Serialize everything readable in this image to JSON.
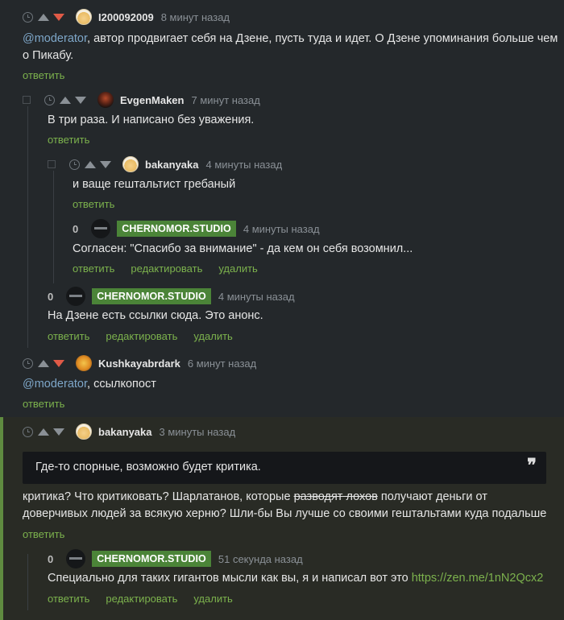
{
  "actions": {
    "reply": "ответить",
    "edit": "редактировать",
    "delete": "удалить"
  },
  "c1": {
    "nick": "I200092009",
    "time": "8 минут назад",
    "mention": "@moderator",
    "text": ", автор продвигает себя на Дзене, пусть туда и идет. О Дзене упоминания больше чем",
    "text2": "о Пикабу."
  },
  "c2": {
    "nick": "EvgenMaken",
    "time": "7 минут назад",
    "text": "В три раза. И написано без уважения."
  },
  "c3": {
    "nick": "bakanyaka",
    "time": "4 минуты назад",
    "text": "и ваще гештальтист гребаный"
  },
  "c4": {
    "rating": "0",
    "badge": "CHERNOMOR.STUDIO",
    "time": "4 минуты назад",
    "text": "Согласен: \"Спасибо за внимание\" - да кем он себя возомнил..."
  },
  "c5": {
    "rating": "0",
    "badge": "CHERNOMOR.STUDIO",
    "time": "4 минуты назад",
    "text": "На Дзене есть ссылки сюда. Это анонс."
  },
  "c6": {
    "nick": "Kushkayabrdark",
    "time": "6 минут назад",
    "mention": "@moderator",
    "text": ", ссылкопост"
  },
  "c7": {
    "nick": "bakanyaka",
    "time": "3 минуты назад",
    "quote": "Где-то спорные, возможно будет критика.",
    "qmark": "❞",
    "line1a": "критика? Что критиковать? Шарлатанов, которые ",
    "line1strike": "разводят лохов",
    "line1b": " получают деньги от",
    "line2": "доверчивых людей за всякую херню? Шли-бы Вы лучше со своими гештальтами куда подальше"
  },
  "c8": {
    "rating": "0",
    "badge": "CHERNOMOR.STUDIO",
    "time": "51 секунда назад",
    "text": "Специально для таких гигантов мысли как вы, я и написал вот это ",
    "link": "https://zen.me/1nN2Qcx2"
  },
  "colors": {
    "background": "#24282b",
    "accent_green": "#7cb24d",
    "badge_green": "#4b8438",
    "downvote_red": "#e05a47",
    "mention_blue": "#7ea7c9",
    "highlight_border": "#5f8b40"
  }
}
